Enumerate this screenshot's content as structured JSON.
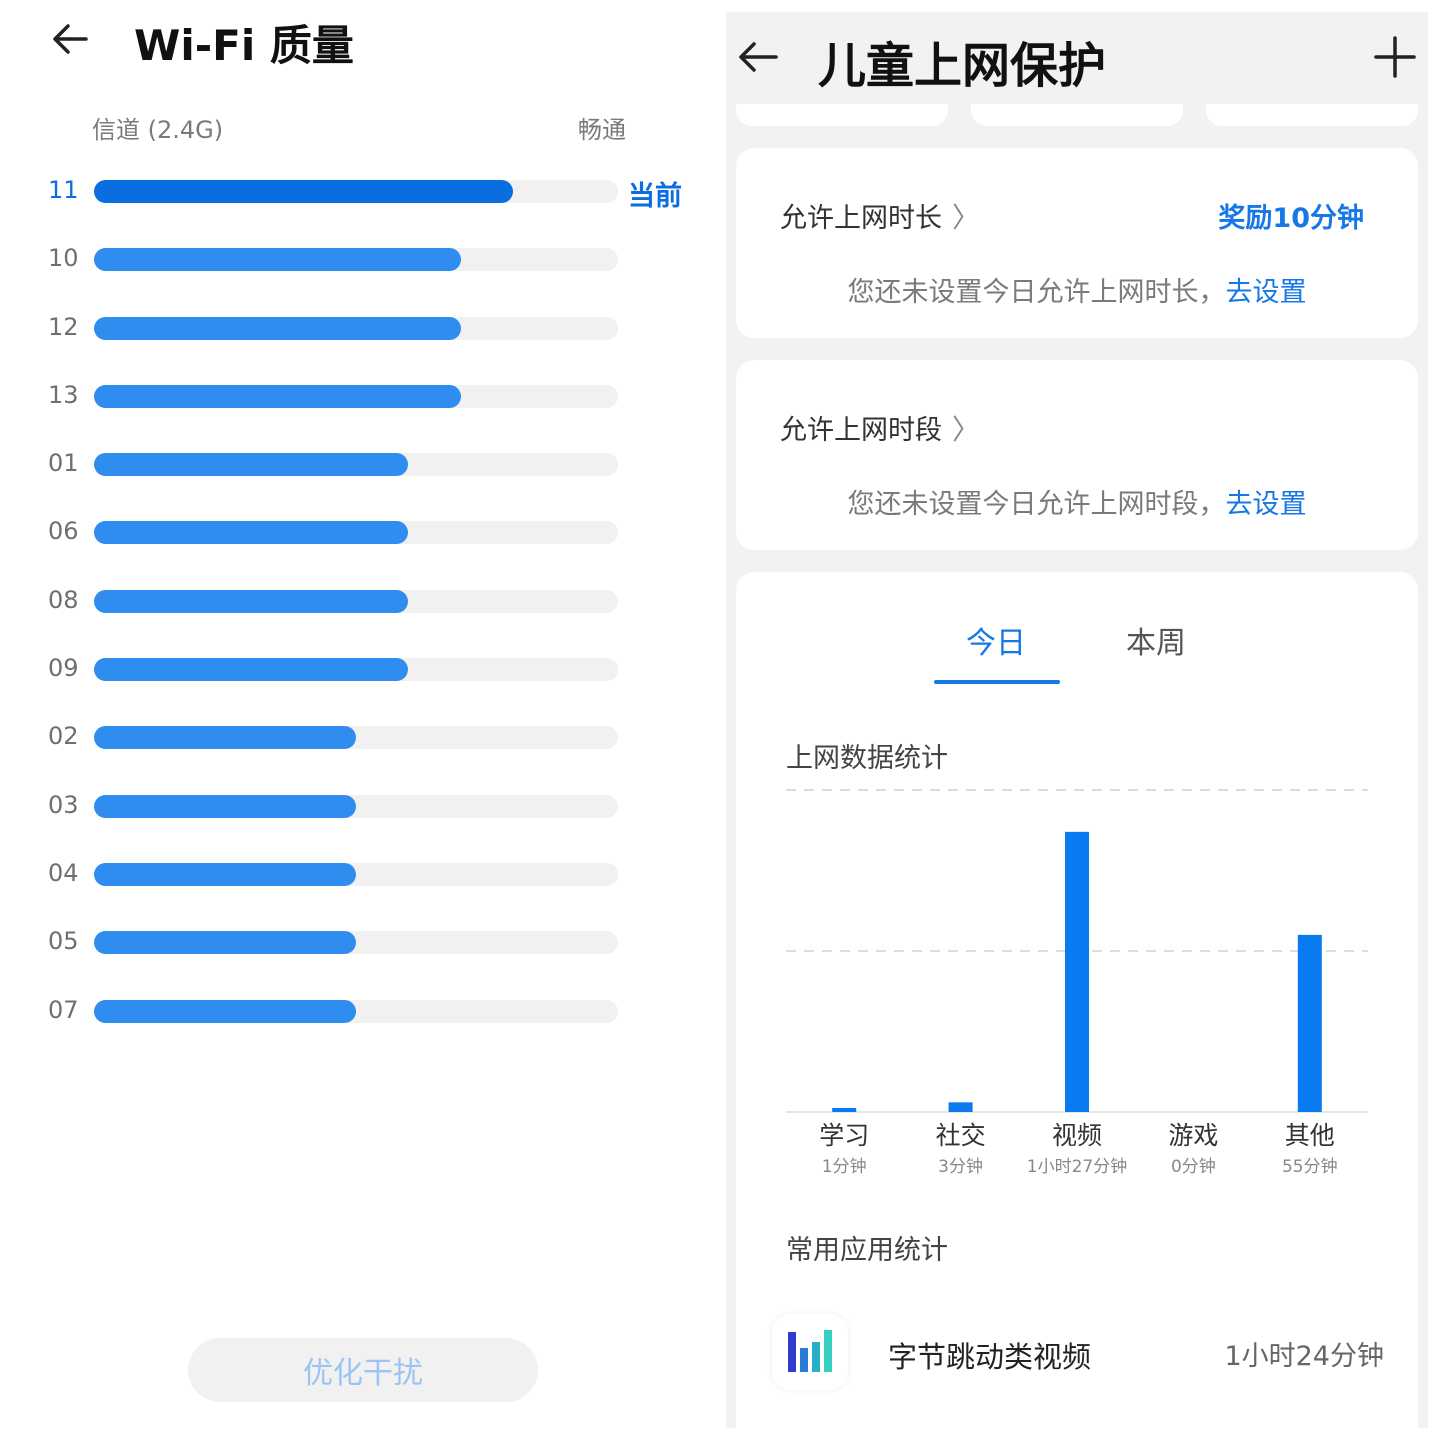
{
  "left": {
    "title": "Wi-Fi 质量",
    "column_label": "信道 (2.4G)",
    "status_label": "畅通",
    "current_tag": "当前",
    "optimize_button": "优化干扰",
    "channels": [
      {
        "num": "11",
        "quality": 0.8,
        "current": true
      },
      {
        "num": "10",
        "quality": 0.7,
        "current": false
      },
      {
        "num": "12",
        "quality": 0.7,
        "current": false
      },
      {
        "num": "13",
        "quality": 0.7,
        "current": false
      },
      {
        "num": "01",
        "quality": 0.6,
        "current": false
      },
      {
        "num": "06",
        "quality": 0.6,
        "current": false
      },
      {
        "num": "08",
        "quality": 0.6,
        "current": false
      },
      {
        "num": "09",
        "quality": 0.6,
        "current": false
      },
      {
        "num": "02",
        "quality": 0.5,
        "current": false
      },
      {
        "num": "03",
        "quality": 0.5,
        "current": false
      },
      {
        "num": "04",
        "quality": 0.5,
        "current": false
      },
      {
        "num": "05",
        "quality": 0.5,
        "current": false
      },
      {
        "num": "07",
        "quality": 0.5,
        "current": false
      }
    ],
    "colors": {
      "current": "#0a6de0",
      "bar": "#2f8df0",
      "track": "#f1f1f1"
    }
  },
  "right": {
    "title": "儿童上网保护",
    "duration_card": {
      "title": "允许上网时长",
      "reward": "奖励10分钟",
      "message": "您还未设置今日允许上网时长，",
      "link": "去设置"
    },
    "period_card": {
      "title": "允许上网时段",
      "message": "您还未设置今日允许上网时段，",
      "link": "去设置"
    },
    "tabs": {
      "today": "今日",
      "week": "本周"
    },
    "stats_title": "上网数据统计",
    "apps_title": "常用应用统计",
    "app": {
      "name": "字节跳动类视频",
      "time": "1小时24分钟"
    },
    "accent": "#1677e6"
  },
  "chart_data": {
    "type": "bar",
    "categories": [
      "学习",
      "社交",
      "视频",
      "游戏",
      "其他"
    ],
    "value_labels": [
      "1分钟",
      "3分钟",
      "1小时27分钟",
      "0分钟",
      "55分钟"
    ],
    "values": [
      1,
      3,
      87,
      0,
      55
    ],
    "unit": "分钟",
    "ylim": [
      0,
      100
    ],
    "grid": "dashed horizontal",
    "color": "#0a7af0"
  }
}
